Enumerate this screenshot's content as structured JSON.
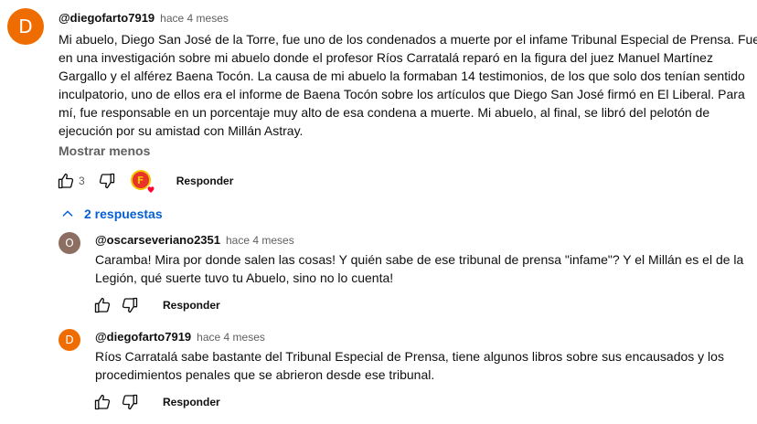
{
  "comment": {
    "avatar_letter": "D",
    "avatar_color": "#ef6c00",
    "author": "@diegofarto7919",
    "time": "hace 4 meses",
    "text_lines": [
      "Mi abuelo, Diego San José de la Torre, fue uno de los condenados a muerte por el infame Tribunal Especial de Prensa. Fue",
      "en una investigación sobre mi abuelo donde el profesor Ríos Carratalá reparó en la figura del juez Manuel Martínez",
      "Gargallo y el alférez Baena Tocón. La causa de mi abuelo la formaban 14 testimonios, de los que solo dos tenían sentido",
      "inculpatorio, uno de ellos era el informe de Baena Tocón sobre los artículos que Diego San José firmó en El Liberal. Para",
      "mí, fue responsable en un porcentaje muy alto de esa condena a muerte. Mi abuelo, al final, se libró del pelotón de",
      "ejecución por su amistad con Millán Astray."
    ],
    "show_less": "Mostrar menos",
    "likes": "3",
    "reply_label": "Responder"
  },
  "replies_toggle": {
    "label": "2 respuestas",
    "icon": "chevron-up-icon"
  },
  "replies": [
    {
      "avatar_letter": "O",
      "avatar_color": "#8d6e63",
      "author": "@oscarseveriano2351",
      "time": "hace 4 meses",
      "text_lines": [
        "Caramba! Mira por donde salen las cosas! Y quién sabe de ese tribunal de prensa \"infame\"? Y el Millán es el de la",
        "Legión, qué suerte tuvo tu Abuelo, sino no lo cuenta!"
      ],
      "reply_label": "Responder"
    },
    {
      "avatar_letter": "D",
      "avatar_color": "#ef6c00",
      "author": "@diegofarto7919",
      "time": "hace 4 meses",
      "text_lines": [
        "Ríos Carratalá sabe bastante del Tribunal Especial de Prensa, tiene algunos libros sobre sus encausados y los",
        "procedimientos penales que se abrieron desde ese tribunal."
      ],
      "reply_label": "Responder"
    }
  ],
  "creator_heart": {
    "badge_letter": "F",
    "icon": "heart-icon",
    "color": "#ff0033"
  },
  "colors": {
    "link": "#065fd4",
    "secondary_text": "#606060"
  }
}
